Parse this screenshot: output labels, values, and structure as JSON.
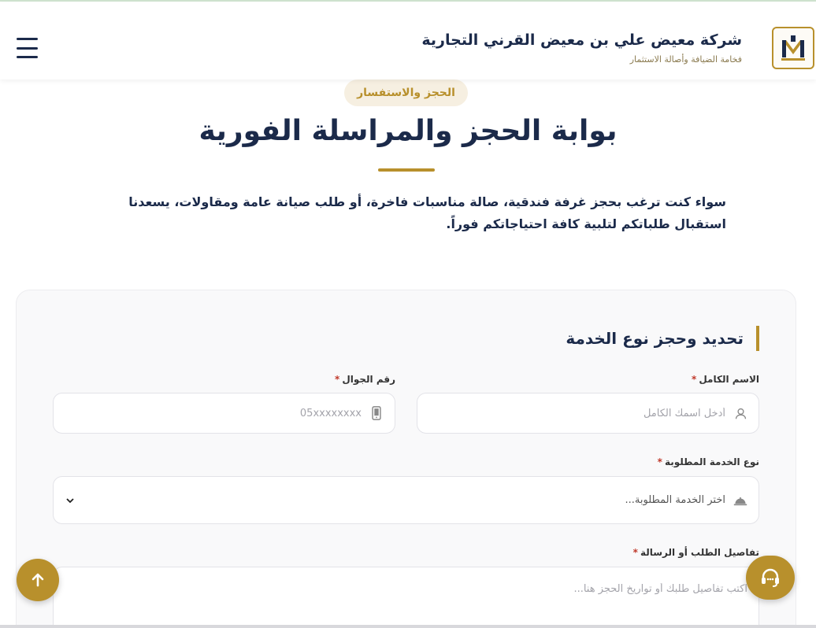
{
  "header": {
    "company_name": "شركة معيض علي بن معيض القرني التجارية",
    "tagline": "فخامة الضيافة وأصالة الاستثمار"
  },
  "hero": {
    "badge": "الحجز والاستفسار",
    "title": "بوابة الحجز والمراسلة الفورية",
    "intro": "سواء كنت ترغب بحجز غرفة فندقية، صالة مناسبات فاخرة، أو طلب صيانة عامة ومقاولات، يسعدنا استقبال طلباتكم لتلبية كافة احتياجاتكم فوراً."
  },
  "form": {
    "section_title": "تحديد وحجز نوع الخدمة",
    "full_name": {
      "label": "الاسم الكامل",
      "placeholder": "أدخل اسمك الكامل",
      "value": ""
    },
    "phone": {
      "label": "رقم الجوال",
      "placeholder": "05xxxxxxxx",
      "value": ""
    },
    "service": {
      "label": "نوع الخدمة المطلوبة",
      "selected": "اختر الخدمة المطلوبة..."
    },
    "details": {
      "label": "تفاصيل الطلب أو الرسالة",
      "placeholder": "اكتب تفاصيل طلبك أو تواريخ الحجز هنا...",
      "value": ""
    },
    "required_mark": "*"
  },
  "icons": {
    "menu": "menu-icon",
    "user": "user-icon",
    "phone": "mobile-phone-icon",
    "service": "bell-icon",
    "chevron": "chevron-down-icon",
    "scroll_top": "arrow-up-icon",
    "support": "headset-icon"
  },
  "colors": {
    "navy": "#1b2a4a",
    "gold": "#b8902c",
    "badge_bg": "#f6efe1",
    "required": "#c0392b"
  }
}
